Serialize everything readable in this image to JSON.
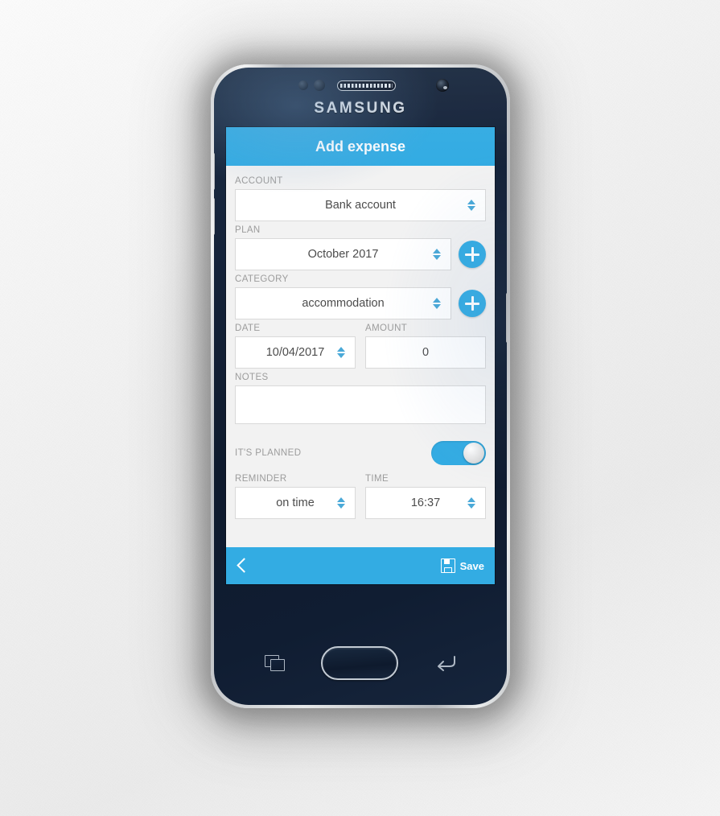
{
  "device": {
    "brand": "SAMSUNG",
    "icons": {
      "earpiece": "earpiece-speaker",
      "front_camera": "front-camera",
      "proximity_sensor": "proximity-sensor",
      "recents": "recents-icon",
      "home": "home-button",
      "back": "back-arrow-icon",
      "volume_up": "volume-up-button",
      "volume_down": "volume-down-button",
      "power": "power-button"
    }
  },
  "app": {
    "header": {
      "title": "Add expense"
    },
    "fields": {
      "account": {
        "label": "ACCOUNT",
        "value": "Bank account"
      },
      "plan": {
        "label": "PLAN",
        "value": "October 2017",
        "add_label": "+"
      },
      "category": {
        "label": "CATEGORY",
        "value": "accommodation",
        "add_label": "+"
      },
      "date": {
        "label": "DATE",
        "value": "10/04/2017"
      },
      "amount": {
        "label": "AMOUNT",
        "value": "0"
      },
      "notes": {
        "label": "NOTES",
        "value": "",
        "placeholder": ""
      },
      "planned": {
        "label": "IT'S PLANNED",
        "state": "on"
      },
      "reminder": {
        "label": "REMINDER",
        "value": "on time"
      },
      "time": {
        "label": "TIME",
        "value": "16:37"
      }
    },
    "bottom_bar": {
      "back_icon": "back-chevron-icon",
      "save_icon": "floppy-disk-icon",
      "save_label": "Save"
    },
    "colors": {
      "accent": "#33ace3",
      "form_background": "#f2f2f2",
      "label_text": "#9c9c9c",
      "value_text": "#4c4c4c",
      "field_border": "#d9d9d9",
      "header_text": "#ffffff"
    }
  }
}
